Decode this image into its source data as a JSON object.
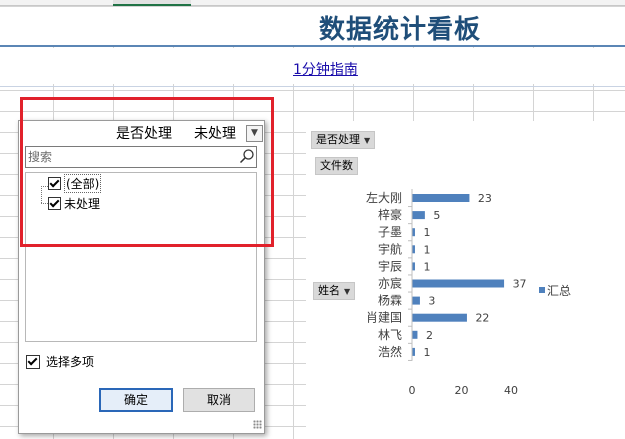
{
  "sheet": {
    "title": "数据统计看板",
    "guide_link": "1分钟指南"
  },
  "filter_panel": {
    "field_label": "是否处理",
    "field_value": "未处理",
    "search_placeholder": "搜索",
    "items": [
      {
        "label": "(全部)",
        "checked": true
      },
      {
        "label": "未处理",
        "checked": true
      }
    ],
    "multi_select_label": "选择多项",
    "multi_select_checked": true,
    "ok_label": "确定",
    "cancel_label": "取消"
  },
  "pivot_buttons": {
    "filter_field": "是否处理",
    "value_field": "文件数",
    "row_field": "姓名"
  },
  "colors": {
    "bar": "#4f81bd",
    "highlight": "#e1212b",
    "title": "#1f4e79"
  },
  "chart_data": {
    "type": "bar",
    "orientation": "horizontal",
    "categories": [
      "左大刚",
      "梓豪",
      "子墨",
      "宇航",
      "宇辰",
      "亦宸",
      "杨霖",
      "肖建国",
      "林飞",
      "浩然"
    ],
    "series": [
      {
        "name": "汇总",
        "values": [
          23,
          5,
          1,
          1,
          1,
          37,
          3,
          22,
          2,
          1
        ]
      }
    ],
    "xlim": [
      0,
      40
    ],
    "xticks": [
      0,
      20,
      40
    ],
    "data_labels": true,
    "legend_position": "right",
    "grid": false
  }
}
